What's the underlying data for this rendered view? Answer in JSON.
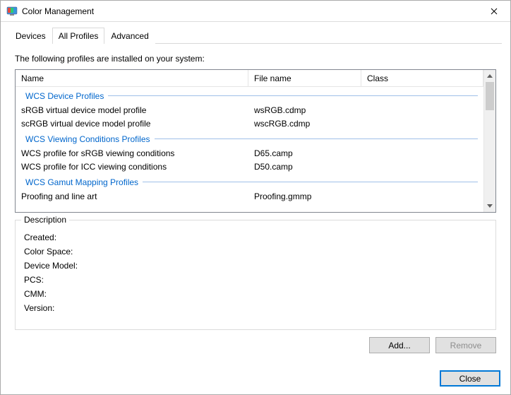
{
  "window": {
    "title": "Color Management"
  },
  "tabs": {
    "devices": "Devices",
    "all_profiles": "All Profiles",
    "advanced": "Advanced"
  },
  "intro": "The following profiles are installed on your system:",
  "columns": {
    "name": "Name",
    "file": "File name",
    "class": "Class"
  },
  "groups": [
    {
      "label": "WCS Device Profiles",
      "rows": [
        {
          "name": "sRGB virtual device model profile",
          "file": "wsRGB.cdmp",
          "class": ""
        },
        {
          "name": "scRGB virtual device model profile",
          "file": "wscRGB.cdmp",
          "class": ""
        }
      ]
    },
    {
      "label": "WCS Viewing Conditions Profiles",
      "rows": [
        {
          "name": "WCS profile for sRGB viewing conditions",
          "file": "D65.camp",
          "class": ""
        },
        {
          "name": "WCS profile for ICC viewing conditions",
          "file": "D50.camp",
          "class": ""
        }
      ]
    },
    {
      "label": "WCS Gamut Mapping Profiles",
      "rows": [
        {
          "name": "Proofing and line art",
          "file": "Proofing.gmmp",
          "class": ""
        }
      ]
    }
  ],
  "description": {
    "legend": "Description",
    "fields": {
      "created": "Created:",
      "color_space": "Color Space:",
      "device_model": "Device Model:",
      "pcs": "PCS:",
      "cmm": "CMM:",
      "version": "Version:"
    }
  },
  "buttons": {
    "add": "Add...",
    "remove": "Remove",
    "close": "Close"
  }
}
